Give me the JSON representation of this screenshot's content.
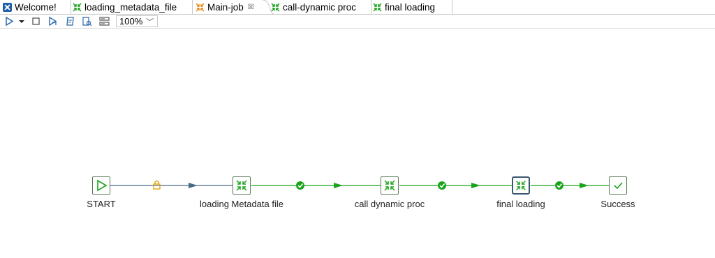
{
  "tabs": [
    {
      "label": "Welcome!",
      "icon": "talend-welcome-icon"
    },
    {
      "label": "loading_metadata_file",
      "icon": "job-icon"
    },
    {
      "label": "Main-job",
      "icon": "main-job-icon",
      "active": true,
      "close": "☒"
    },
    {
      "label": "call-dynamic proc",
      "icon": "job-icon"
    },
    {
      "label": "final loading",
      "icon": "job-icon"
    }
  ],
  "toolbar": {
    "zoom": "100%"
  },
  "nodes": [
    {
      "label": "START",
      "icon": "play-icon"
    },
    {
      "label": "loading Metadata file",
      "icon": "tRunJob-icon"
    },
    {
      "label": "call dynamic proc",
      "icon": "tRunJob-icon"
    },
    {
      "label": "final loading",
      "icon": "tRunJob-icon",
      "selected": true
    },
    {
      "label": "Success",
      "icon": "check-icon"
    }
  ],
  "colors": {
    "link_main": "#4a6b86",
    "link_ok": "#1aa31a",
    "lock": "#e0a000",
    "node_border": "#5a7a5a",
    "selected_border": "#3b5870"
  }
}
